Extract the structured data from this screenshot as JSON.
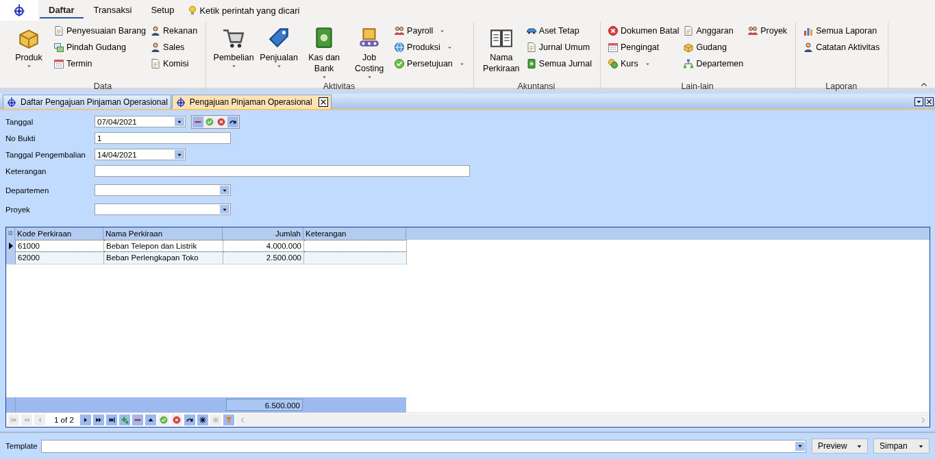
{
  "menu_tabs": [
    {
      "label": "Daftar",
      "selected": true
    },
    {
      "label": "Transaksi",
      "selected": false
    },
    {
      "label": "Setup",
      "selected": false
    }
  ],
  "command_search": {
    "placeholder": "Ketik perintah yang dicari"
  },
  "ribbon_groups": [
    {
      "title": "Data",
      "columns": [
        [
          {
            "label": "Produk",
            "kind": "large",
            "dropdown": true
          }
        ],
        [
          {
            "label": "Penyesuaian Barang",
            "kind": "small",
            "dropdown": false
          },
          {
            "label": "Pindah Gudang",
            "kind": "small",
            "dropdown": false
          },
          {
            "label": "Termin",
            "kind": "small",
            "dropdown": false
          }
        ],
        [
          {
            "label": "Rekanan",
            "kind": "small",
            "dropdown": false
          },
          {
            "label": "Sales",
            "kind": "small",
            "dropdown": false
          },
          {
            "label": "Komisi",
            "kind": "small",
            "dropdown": false
          }
        ]
      ]
    },
    {
      "title": "Aktivitas",
      "columns": [
        [
          {
            "label": "Pembelian",
            "kind": "large",
            "dropdown": true
          }
        ],
        [
          {
            "label": "Penjualan",
            "kind": "large",
            "dropdown": true
          }
        ],
        [
          {
            "label": "Kas dan Bank",
            "kind": "large",
            "dropdown": true
          }
        ],
        [
          {
            "label": "Job Costing",
            "kind": "large",
            "dropdown": true
          }
        ],
        [
          {
            "label": "Payroll",
            "kind": "small",
            "dropdown": true
          },
          {
            "label": "Produksi",
            "kind": "small",
            "dropdown": true
          },
          {
            "label": "Persetujuan",
            "kind": "small",
            "dropdown": true
          }
        ]
      ]
    },
    {
      "title": "Akuntansi",
      "columns": [
        [
          {
            "label": "Nama Perkiraan",
            "kind": "large",
            "dropdown": false
          }
        ],
        [
          {
            "label": "Aset Tetap",
            "kind": "small",
            "dropdown": false
          },
          {
            "label": "Jurnal Umum",
            "kind": "small",
            "dropdown": false
          },
          {
            "label": "Semua Jurnal",
            "kind": "small",
            "dropdown": false
          }
        ]
      ]
    },
    {
      "title": "Lain-lain",
      "columns": [
        [
          {
            "label": "Dokumen Batal",
            "kind": "small",
            "dropdown": false
          },
          {
            "label": "Pengingat",
            "kind": "small",
            "dropdown": false
          },
          {
            "label": "Kurs",
            "kind": "small",
            "dropdown": true
          }
        ],
        [
          {
            "label": "Anggaran",
            "kind": "small",
            "dropdown": false
          },
          {
            "label": "Gudang",
            "kind": "small",
            "dropdown": false
          },
          {
            "label": "Departemen",
            "kind": "small",
            "dropdown": false
          }
        ],
        [
          {
            "label": "Proyek",
            "kind": "small",
            "dropdown": false
          }
        ]
      ]
    },
    {
      "title": "Laporan",
      "columns": [
        [
          {
            "label": "Semua Laporan",
            "kind": "small",
            "dropdown": false
          },
          {
            "label": "Catatan Aktivitas",
            "kind": "small",
            "dropdown": false
          }
        ]
      ]
    }
  ],
  "document_tabs": [
    {
      "label": "Daftar Pengajuan Pinjaman Operasional",
      "selected": false,
      "closable": false
    },
    {
      "label": "Pengajuan Pinjaman Operasional",
      "selected": true,
      "closable": true
    }
  ],
  "form_fields": [
    {
      "label": "Tanggal",
      "kind": "date",
      "value": "07/04/2021",
      "record_buttons": [
        {
          "kind": "minus",
          "disabled": false
        },
        {
          "kind": "check",
          "disabled": true
        },
        {
          "kind": "cross",
          "disabled": true
        },
        {
          "kind": "redo",
          "disabled": false
        }
      ]
    },
    {
      "label": "No Bukti",
      "kind": "text",
      "value": "1"
    },
    {
      "label": "Tanggal Pengembalian",
      "kind": "date",
      "value": "14/04/2021"
    },
    {
      "label": "Keterangan",
      "kind": "wide_text"
    },
    {
      "label": "Departemen",
      "kind": "combo"
    },
    {
      "label": "Proyek",
      "kind": "combo"
    }
  ],
  "table": {
    "columns": [
      "Kode Perkiraan",
      "Nama Perkiraan",
      "Jumlah",
      "Keterangan"
    ],
    "rows": [
      {
        "cells": [
          "61000",
          "Beban Telepon dan Listrik",
          "4.000.000",
          ""
        ],
        "selected": true
      },
      {
        "cells": [
          "62000",
          "Beban Perlengkapan Toko",
          "2.500.000",
          ""
        ],
        "selected": false
      }
    ],
    "total": "6.500.000",
    "navigator": {
      "position": "1 of 2",
      "buttons": [
        {
          "kind": "first",
          "disabled": true
        },
        {
          "kind": "prev_page",
          "disabled": true
        },
        {
          "kind": "prev",
          "disabled": true
        },
        {
          "kind": "next",
          "disabled": false
        },
        {
          "kind": "next_page",
          "disabled": false
        },
        {
          "kind": "last",
          "disabled": false
        },
        {
          "kind": "add",
          "disabled": false
        },
        {
          "kind": "minus",
          "disabled": false
        },
        {
          "kind": "up",
          "disabled": false
        },
        {
          "kind": "check",
          "disabled": true
        },
        {
          "kind": "cross",
          "disabled": true
        },
        {
          "kind": "redo",
          "disabled": false
        },
        {
          "kind": "asterisk",
          "disabled": false
        },
        {
          "kind": "asterisk_arrow",
          "disabled": true
        },
        {
          "kind": "filter",
          "disabled": false
        }
      ]
    }
  },
  "footer": {
    "template_label": "Template",
    "buttons": [
      {
        "label": "Preview",
        "dropdown": true
      },
      {
        "label": "Simpan",
        "dropdown": true
      }
    ]
  }
}
